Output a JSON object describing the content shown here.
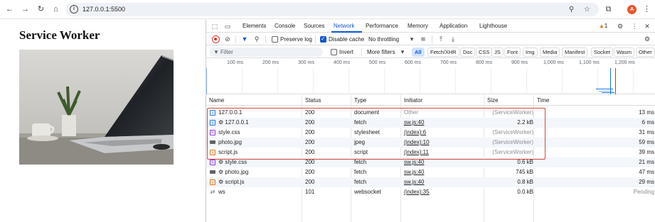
{
  "browser": {
    "url": "127.0.0.1:5500",
    "avatar_letter": "A"
  },
  "page": {
    "title": "Service Worker",
    "image": "laptop-photo"
  },
  "devtools": {
    "tabs": [
      "Elements",
      "Console",
      "Sources",
      "Network",
      "Performance",
      "Memory",
      "Application",
      "Lighthouse"
    ],
    "active_tab": "Network",
    "warning_count": "1",
    "toolbar": {
      "preserve_log": "Preserve log",
      "disable_cache": "Disable cache",
      "throttling": "No throttling"
    },
    "filter": {
      "placeholder": "Filter",
      "invert": "Invert",
      "more_filters": "More filters",
      "chips": [
        "All",
        "Fetch/XHR",
        "Doc",
        "CSS",
        "JS",
        "Font",
        "Img",
        "Media",
        "Manifest",
        "Socket",
        "Wasm",
        "Other"
      ],
      "active_chip": "All"
    },
    "overview_ticks": [
      "100 ms",
      "200 ms",
      "300 ms",
      "400 ms",
      "500 ms",
      "600 ms",
      "700 ms",
      "800 ms",
      "900 ms",
      "1,000 ms",
      "1,100 ms",
      "1,200 ms"
    ],
    "columns": {
      "name": "Name",
      "status": "Status",
      "type": "Type",
      "initiator": "Initiator",
      "size": "Size",
      "time": "Time"
    },
    "requests": [
      {
        "icon": "doc",
        "name": "127.0.0.1",
        "status": "200",
        "type": "document",
        "initiator": "Other",
        "initiator_link": false,
        "size": "(ServiceWorker)",
        "time": "13 ms"
      },
      {
        "icon": "doc",
        "name": "⚙ 127.0.0.1",
        "status": "200",
        "type": "fetch",
        "initiator": "sw.js:40",
        "initiator_link": true,
        "size": "2.2 kB",
        "time": "6 ms"
      },
      {
        "icon": "css",
        "name": "style.css",
        "status": "200",
        "type": "stylesheet",
        "initiator": "(index):6",
        "initiator_link": true,
        "size": "(ServiceWorker)",
        "time": "31 ms"
      },
      {
        "icon": "img",
        "name": "photo.jpg",
        "status": "200",
        "type": "jpeg",
        "initiator": "(index):10",
        "initiator_link": true,
        "size": "(ServiceWorker)",
        "time": "59 ms"
      },
      {
        "icon": "js",
        "name": "script.js",
        "status": "200",
        "type": "script",
        "initiator": "(index):11",
        "initiator_link": true,
        "size": "(ServiceWorker)",
        "time": "39 ms"
      },
      {
        "icon": "css",
        "name": "⚙ style.css",
        "status": "200",
        "type": "fetch",
        "initiator": "sw.js:40",
        "initiator_link": true,
        "size": "0.6 kB",
        "time": "21 ms"
      },
      {
        "icon": "img",
        "name": "⚙ photo.jpg",
        "status": "200",
        "type": "fetch",
        "initiator": "sw.js:40",
        "initiator_link": true,
        "size": "745 kB",
        "time": "47 ms"
      },
      {
        "icon": "js",
        "name": "⚙ script.js",
        "status": "200",
        "type": "fetch",
        "initiator": "sw.js:40",
        "initiator_link": true,
        "size": "0.8 kB",
        "time": "29 ms"
      },
      {
        "icon": "ws",
        "name": "ws",
        "status": "101",
        "type": "websocket",
        "initiator": "(index):35",
        "initiator_link": true,
        "size": "0.0 kB",
        "time": "Pending"
      }
    ]
  },
  "colors": {
    "accent": "#0b57d0",
    "record": "#dc362e",
    "highlight": "#d6463a",
    "warning": "#e37400"
  }
}
